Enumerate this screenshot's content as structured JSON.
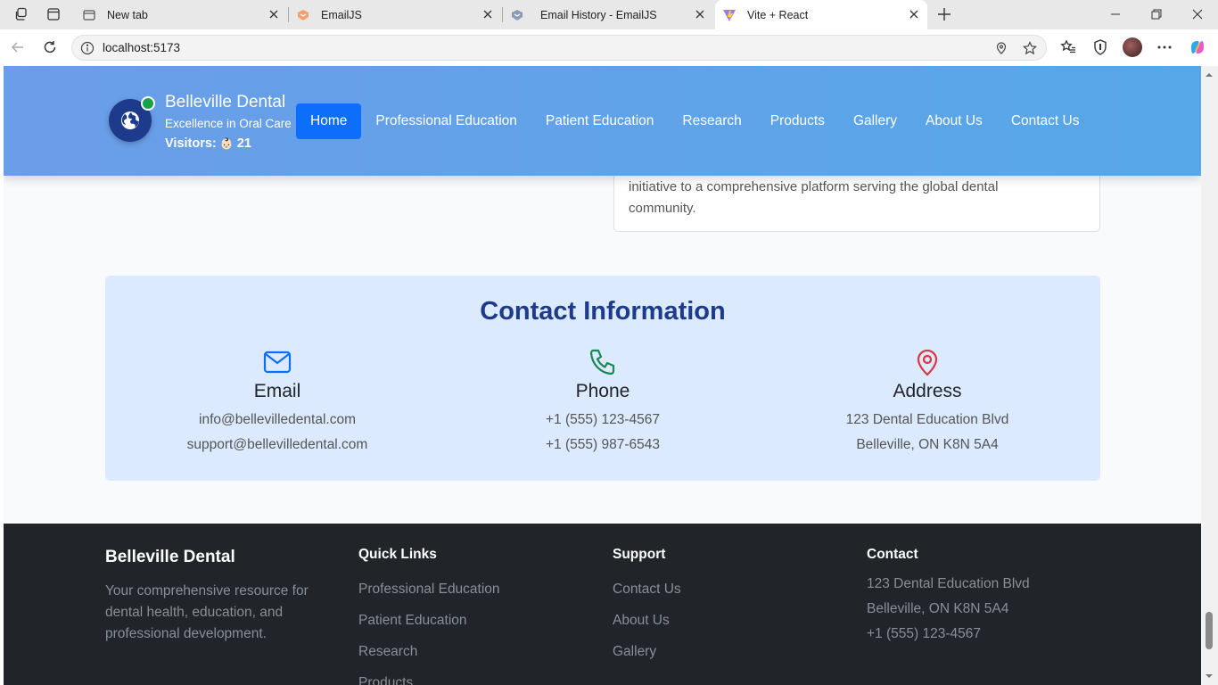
{
  "browser": {
    "tabs": [
      {
        "title": "New tab",
        "icon": "new-tab-page-icon"
      },
      {
        "title": "EmailJS",
        "icon": "emailjs-favicon"
      },
      {
        "title": "Email History - EmailJS",
        "icon": "emailjs-favicon"
      },
      {
        "title": "Vite + React",
        "icon": "vite-favicon",
        "active": true
      }
    ],
    "url": "localhost:5173"
  },
  "header": {
    "brand_name": "Belleville Dental",
    "tagline": "Excellence in Oral Care",
    "visitors_label": "Visitors:",
    "visitors_icon": "👶🏻",
    "visitors_count": "21",
    "nav": [
      {
        "label": "Home",
        "active": true
      },
      {
        "label": "Professional Education"
      },
      {
        "label": "Patient Education"
      },
      {
        "label": "Research"
      },
      {
        "label": "Products"
      },
      {
        "label": "Gallery"
      },
      {
        "label": "About Us"
      },
      {
        "label": "Contact Us"
      }
    ]
  },
  "about_fragment": {
    "text": "initiative to a comprehensive platform serving the global dental community."
  },
  "contact": {
    "title": "Contact Information",
    "columns": [
      {
        "heading": "Email",
        "icon": "mail-icon",
        "lines": [
          "info@bellevilledental.com",
          "support@bellevilledental.com"
        ]
      },
      {
        "heading": "Phone",
        "icon": "phone-icon",
        "lines": [
          "+1 (555) 123-4567",
          "+1 (555) 987-6543"
        ]
      },
      {
        "heading": "Address",
        "icon": "map-pin-icon",
        "lines": [
          "123 Dental Education Blvd",
          "Belleville, ON K8N 5A4"
        ]
      }
    ]
  },
  "footer": {
    "brand": "Belleville Dental",
    "description": "Your comprehensive resource for dental health, education, and professional development.",
    "quick_links": {
      "heading": "Quick Links",
      "items": [
        "Professional Education",
        "Patient Education",
        "Research",
        "Products"
      ]
    },
    "support": {
      "heading": "Support",
      "items": [
        "Contact Us",
        "About Us",
        "Gallery"
      ]
    },
    "contact": {
      "heading": "Contact",
      "lines": [
        "123 Dental Education Blvd",
        "Belleville, ON K8N 5A4",
        "+1 (555) 123-4567"
      ]
    }
  },
  "colors": {
    "header_gradient_start": "#6b9de8",
    "header_gradient_end": "#56a7e8",
    "nav_active": "#0d6efd",
    "contact_bg": "#dbeafe",
    "contact_title": "#1e3a8a",
    "email_icon": "#0d6efd",
    "phone_icon": "#198754",
    "address_icon": "#dc3545",
    "footer_bg": "#212529"
  }
}
